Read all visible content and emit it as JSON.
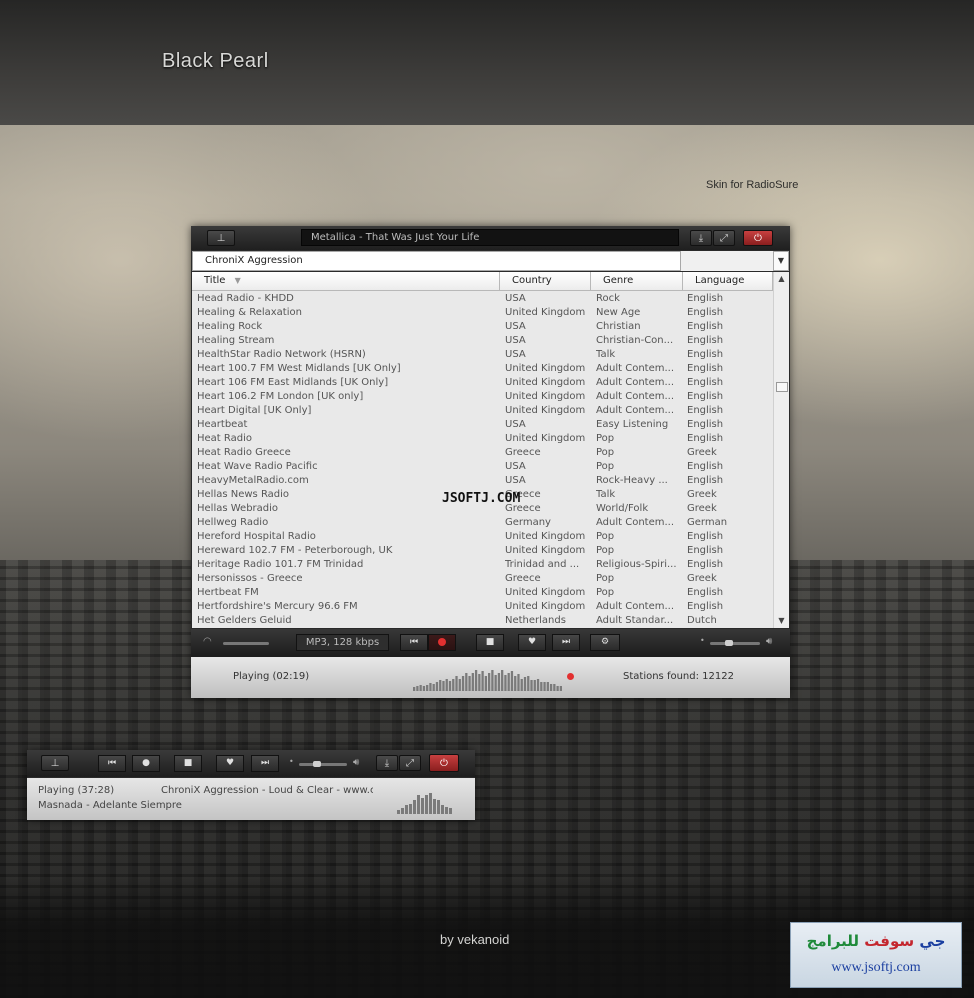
{
  "branding": {
    "title": "Black Pearl",
    "caption": "Skin for RadioSure",
    "author": "by vekanoid"
  },
  "main_window": {
    "now_playing": "Metallica - That Was Just Your Life",
    "pin_icon": "pin-icon",
    "download_icon": "download-icon",
    "expand_icon": "expand-icon",
    "power_icon": "power-icon",
    "filter_value": "ChroniX Aggression",
    "columns": {
      "title": "Title",
      "country": "Country",
      "genre": "Genre",
      "language": "Language"
    },
    "stations": [
      {
        "title": "Head Radio - KHDD",
        "country": "USA",
        "genre": "Rock",
        "language": "English"
      },
      {
        "title": "Healing & Relaxation",
        "country": "United Kingdom",
        "genre": "New Age",
        "language": "English"
      },
      {
        "title": "Healing Rock",
        "country": "USA",
        "genre": "Christian",
        "language": "English"
      },
      {
        "title": "Healing Stream",
        "country": "USA",
        "genre": "Christian-Con...",
        "language": "English"
      },
      {
        "title": "HealthStar Radio Network (HSRN)",
        "country": "USA",
        "genre": "Talk",
        "language": "English"
      },
      {
        "title": "Heart 100.7 FM West Midlands [UK Only]",
        "country": "United Kingdom",
        "genre": "Adult Contem...",
        "language": "English"
      },
      {
        "title": "Heart 106 FM East Midlands [UK Only]",
        "country": "United Kingdom",
        "genre": "Adult Contem...",
        "language": "English"
      },
      {
        "title": "Heart 106.2 FM London [UK only]",
        "country": "United Kingdom",
        "genre": "Adult Contem...",
        "language": "English"
      },
      {
        "title": "Heart Digital [UK Only]",
        "country": "United Kingdom",
        "genre": "Adult Contem...",
        "language": "English"
      },
      {
        "title": "Heartbeat",
        "country": "USA",
        "genre": "Easy Listening",
        "language": "English"
      },
      {
        "title": "Heat Radio",
        "country": "United Kingdom",
        "genre": "Pop",
        "language": "English"
      },
      {
        "title": "Heat Radio Greece",
        "country": "Greece",
        "genre": "Pop",
        "language": "Greek"
      },
      {
        "title": "Heat Wave Radio Pacific",
        "country": "USA",
        "genre": "Pop",
        "language": "English"
      },
      {
        "title": "HeavyMetalRadio.com",
        "country": "USA",
        "genre": "Rock-Heavy ...",
        "language": "English"
      },
      {
        "title": "Hellas News Radio",
        "country": "Greece",
        "genre": "Talk",
        "language": "Greek"
      },
      {
        "title": "Hellas Webradio",
        "country": "Greece",
        "genre": "World/Folk",
        "language": "Greek"
      },
      {
        "title": "Hellweg Radio",
        "country": "Germany",
        "genre": "Adult Contem...",
        "language": "German"
      },
      {
        "title": "Hereford Hospital Radio",
        "country": "United Kingdom",
        "genre": "Pop",
        "language": "English"
      },
      {
        "title": "Hereward 102.7 FM - Peterborough, UK",
        "country": "United Kingdom",
        "genre": "Pop",
        "language": "English"
      },
      {
        "title": "Heritage Radio 101.7 FM Trinidad",
        "country": "Trinidad and ...",
        "genre": "Religious-Spiri...",
        "language": "English"
      },
      {
        "title": "Hersonissos - Greece",
        "country": "Greece",
        "genre": "Pop",
        "language": "Greek"
      },
      {
        "title": "Hertbeat FM",
        "country": "United Kingdom",
        "genre": "Pop",
        "language": "English"
      },
      {
        "title": "Hertfordshire's Mercury 96.6 FM",
        "country": "United Kingdom",
        "genre": "Adult Contem...",
        "language": "English"
      },
      {
        "title": "Het Gelders Geluid",
        "country": "Netherlands",
        "genre": "Adult Standar...",
        "language": "Dutch"
      }
    ],
    "format": "MP3, 128 kbps",
    "status_playing": "Playing (02:19)",
    "stations_found": "Stations found: 12122"
  },
  "mini_player": {
    "playing": "Playing (37:28)",
    "stream": "ChroniX Aggression - Loud & Clear - www.ch",
    "track": "Masnada - Adelante Siempre"
  },
  "watermark": {
    "center": "JSOFTJ.COM",
    "arabic_part1": "جي",
    "arabic_part2": "سوفت",
    "arabic_part3": "للبرامج",
    "url": "www.jsoftj.com"
  },
  "colors": {
    "accent_red": "#c84040",
    "record_red": "#e23030",
    "list_bg": "#e9e9e9",
    "chrome_dark": "#2a2a2a"
  }
}
